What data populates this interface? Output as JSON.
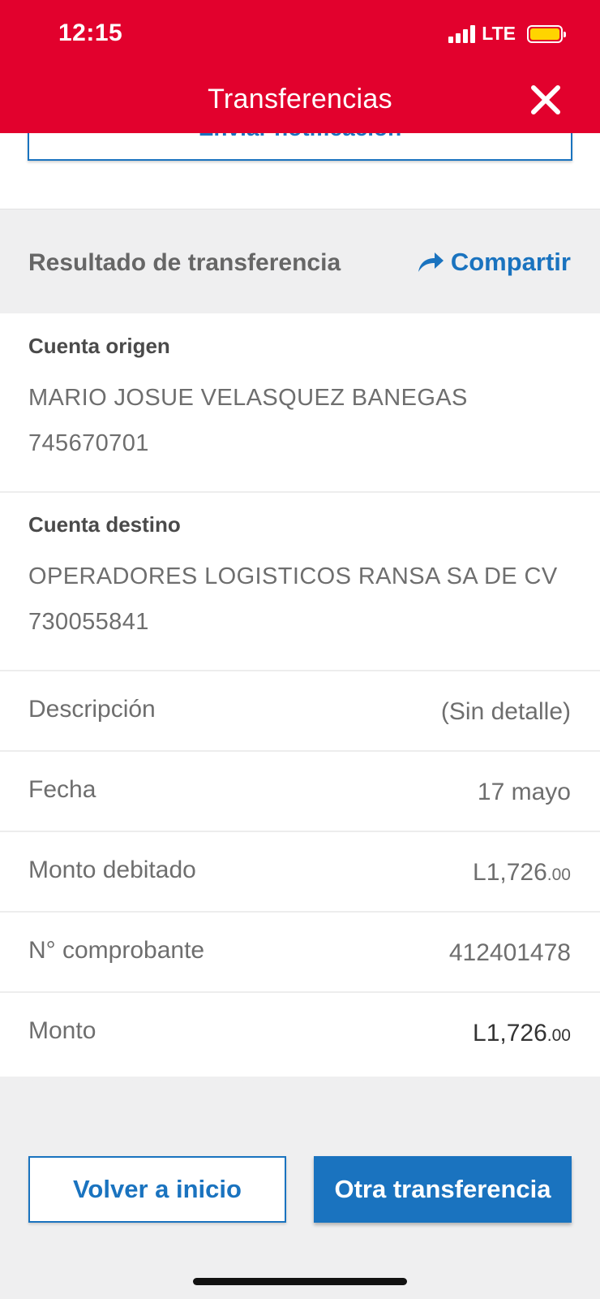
{
  "status_bar": {
    "time": "12:15",
    "network": "LTE",
    "battery_color": "#ffd400"
  },
  "header": {
    "title": "Transferencias",
    "close_icon": "close-icon",
    "background": "#e2012d"
  },
  "notify_button": {
    "label": "Enviar notificación"
  },
  "result": {
    "title": "Resultado de transferencia",
    "share_label": "Compartir",
    "share_icon": "share-arrow-icon",
    "accent": "#1a73bf"
  },
  "origin": {
    "label": "Cuenta origen",
    "name": "MARIO JOSUE VELASQUEZ BANEGAS",
    "number": "745670701"
  },
  "destination": {
    "label": "Cuenta destino",
    "name": "OPERADORES LOGISTICOS RANSA SA DE CV",
    "number": "730055841"
  },
  "details": [
    {
      "label": "Descripción",
      "value": "(Sin detalle)"
    },
    {
      "label": "Fecha",
      "value": "17 mayo"
    },
    {
      "label": "Monto debitado",
      "value": "L1,726",
      "cents": ".00"
    },
    {
      "label": "N° comprobante",
      "value": "412401478"
    },
    {
      "label": "Monto",
      "value": "L1,726",
      "cents": ".00"
    }
  ],
  "actions": {
    "back_home": "Volver a inicio",
    "another_transfer": "Otra transferencia"
  }
}
